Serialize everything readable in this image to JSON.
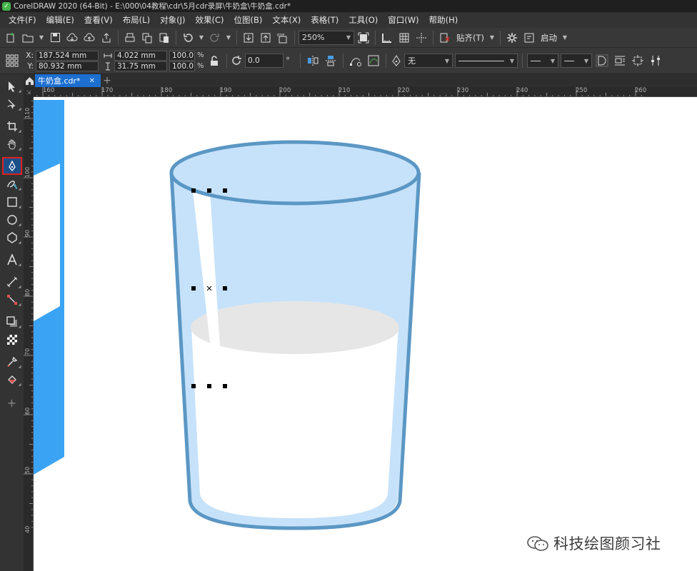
{
  "window": {
    "title": "CorelDRAW 2020 (64-Bit) - E:\\000\\04教程\\cdr\\5月cdr录屏\\牛奶盒\\牛奶盒.cdr*"
  },
  "menu": [
    {
      "label": "文件(F)"
    },
    {
      "label": "编辑(E)"
    },
    {
      "label": "查看(V)"
    },
    {
      "label": "布局(L)"
    },
    {
      "label": "对象(J)"
    },
    {
      "label": "效果(C)"
    },
    {
      "label": "位图(B)"
    },
    {
      "label": "文本(X)"
    },
    {
      "label": "表格(T)"
    },
    {
      "label": "工具(O)"
    },
    {
      "label": "窗口(W)"
    },
    {
      "label": "帮助(H)"
    }
  ],
  "toolbar": {
    "zoom": "250%",
    "snap_label": "贴齐(T)",
    "launch_label": "启动",
    "export_pdf": "PDF"
  },
  "propbar": {
    "x_label": "X:",
    "y_label": "Y:",
    "x_value": "187.524 mm",
    "y_value": "80.932 mm",
    "width_value": "4.022 mm",
    "height_value": "31.75 mm",
    "scale_x": "100.0",
    "scale_y": "100.0",
    "percent": "%",
    "rotation": "0.0",
    "degree": "°",
    "fill_value": "无"
  },
  "tabs": {
    "document": "牛奶盒.cdr*"
  },
  "ruler": {
    "h_ticks": [
      "160",
      "170",
      "180",
      "190",
      "200",
      "210",
      "220",
      "230",
      "240",
      "250",
      "260"
    ],
    "v_ticks": [
      "110",
      "100",
      "90",
      "80",
      "70",
      "60",
      "50",
      "40"
    ]
  },
  "watermark": {
    "text": "科技绘图颜习社"
  },
  "colors": {
    "accent_blue": "#1c6fd1",
    "cup_outline": "#5b97c4",
    "cup_fill_light": "#c6e2fa",
    "milk_top": "#e6e6e6",
    "box_blue": "#3ba3f4",
    "selected_tool_border": "#e02020"
  }
}
